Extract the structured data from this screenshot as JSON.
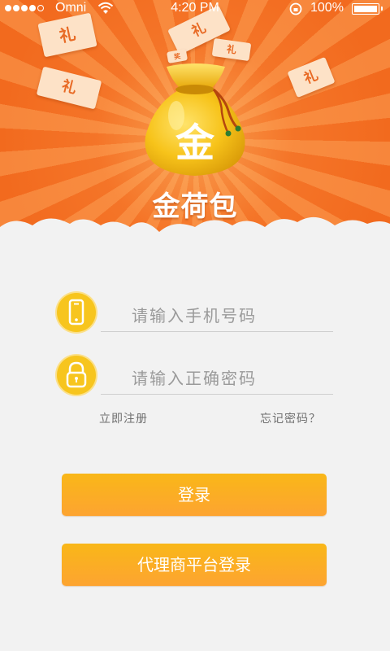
{
  "status_bar": {
    "carrier": "Omni",
    "time": "4:20 PM",
    "battery": "100%"
  },
  "hero": {
    "card_chars": [
      "礼",
      "礼",
      "礼",
      "礼",
      "礼",
      "奖"
    ],
    "bag_char": "金",
    "brand": "金荷包"
  },
  "form": {
    "phone_placeholder": "请输入手机号码",
    "phone_value": "",
    "password_placeholder": "请输入正确密码",
    "password_value": "",
    "register_link": "立即注册",
    "forgot_link": "忘记密码？"
  },
  "buttons": {
    "login": "登录",
    "agent_login": "代理商平台登录"
  },
  "colors": {
    "hero_orange": "#f26a1e",
    "field_icon": "#f7c51e",
    "button": "#fbae22"
  }
}
